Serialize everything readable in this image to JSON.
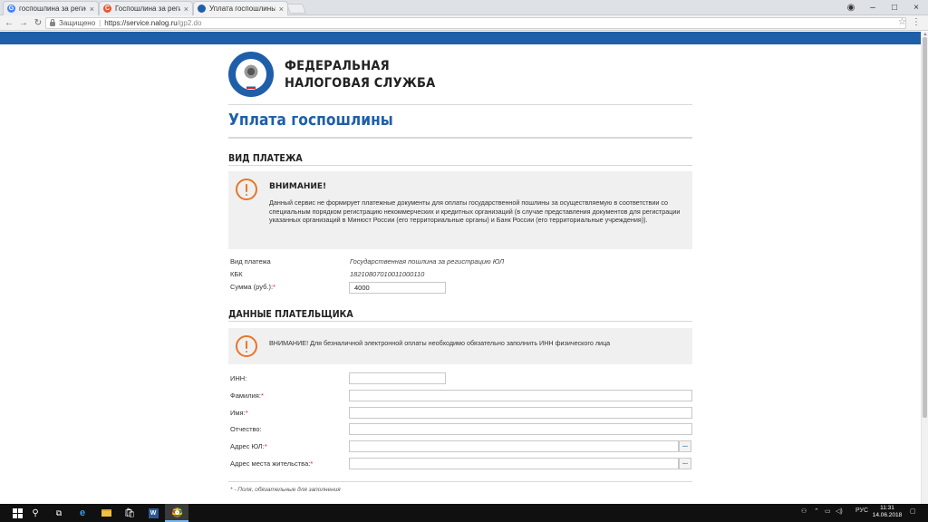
{
  "browser": {
    "tabs": [
      {
        "title": "госпошлина за регистрацию",
        "favicon": "google-icon",
        "color": "#4285f4"
      },
      {
        "title": "Госпошлина за регистрацию",
        "favicon": "c-icon",
        "color": "#e8552a"
      },
      {
        "title": "Уплата госпошлины",
        "favicon": "fns-icon",
        "color": "#1f5fa9"
      }
    ],
    "security_label": "Защищено",
    "url_host": "https://service.nalog.ru",
    "url_path": "/gp2.do"
  },
  "header": {
    "brand_line1": "ФЕДЕРАЛЬНАЯ",
    "brand_line2": "НАЛОГОВАЯ СЛУЖБА"
  },
  "page": {
    "title": "Уплата госпошлины"
  },
  "payment_section": {
    "title": "ВИД ПЛАТЕЖА",
    "alert_head": "ВНИМАНИЕ!",
    "alert_text": "Данный сервис не формирует платежные документы для оплаты государственной пошлины за осуществляемую в соответствии со специальным порядком регистрацию некоммерческих и кредитных организаций (в случае представления документов для регистрации указанных организаций в Минюст России (его территориальные органы) и Банк России (его территориальные учреждения)).",
    "rows": [
      {
        "label": "Вид платежа",
        "value": "Государственная пошлина за регистрацию ЮЛ"
      },
      {
        "label": "КБК",
        "value": "18210807010011000110"
      }
    ],
    "sum_label": "Сумма (руб.):",
    "sum_value": "4000"
  },
  "payer_section": {
    "title": "ДАННЫЕ ПЛАТЕЛЬЩИКА",
    "alert_text": "ВНИМАНИЕ! Для безналичной электронной оплаты необходимо обязательно заполнить ИНН физического лица",
    "inn_label": "ИНН:",
    "surname_label": "Фамилия:",
    "name_label": "Имя:",
    "patronymic_label": "Отчество:",
    "address_ul_label": "Адрес ЮЛ:",
    "address_res_label": "Адрес места жительства:",
    "lookup_button": "...",
    "required_mark": "*",
    "footnote": "* - Поля, обязательные для заполнения"
  },
  "taskbar": {
    "language": "РУС",
    "time": "11:31",
    "date": "14.06.2018"
  }
}
